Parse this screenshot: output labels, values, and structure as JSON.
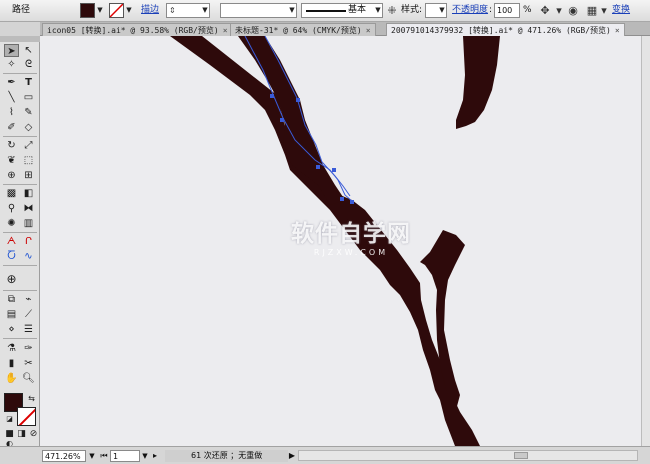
{
  "control_bar": {
    "path_label": "路径",
    "fill_color": "#2e0a0b",
    "stroke_label": "描边",
    "stroke_weight": "",
    "brush_label": "基本",
    "style_label": "样式",
    "opacity_label": "不透明度",
    "opacity_value": "100",
    "opacity_unit": "%",
    "transform_label": "变换"
  },
  "tabs": [
    {
      "label": "icon05 [转换].ai* @ 93.58% (RGB/预览)"
    },
    {
      "label": "未标题-31* @ 64% (CMYK/预览)"
    },
    {
      "label": "200791014379932 [转换].ai* @ 471.26% (RGB/预览)",
      "active": true
    }
  ],
  "tools_icons": [
    "selection-icon",
    "direct-selection-icon",
    "magic-wand-icon",
    "lasso-icon",
    "pen-icon",
    "type-icon",
    "line-icon",
    "rectangle-icon",
    "paintbrush-icon",
    "pencil-icon",
    "blob-brush-icon",
    "eraser-icon",
    "rotate-icon",
    "scale-icon",
    "warp-icon",
    "free-transform-icon",
    "shape-builder-icon",
    "perspective-icon",
    "mesh-icon",
    "gradient-icon",
    "eyedropper-icon",
    "blend-icon",
    "symbol-sprayer-icon",
    "column-graph-icon",
    "artboard-icon",
    "slice-icon",
    "hand-icon",
    "zoom-icon"
  ],
  "canvas": {
    "artwork_color": "#2e0a0b",
    "path_color": "#3a5bd8",
    "watermark_title": "软件自学网",
    "watermark_url": "RJZXW.COM"
  },
  "status_bar": {
    "zoom": "471.26%",
    "artboard": "1",
    "undo_text": "61 次还原 ；无重做"
  }
}
